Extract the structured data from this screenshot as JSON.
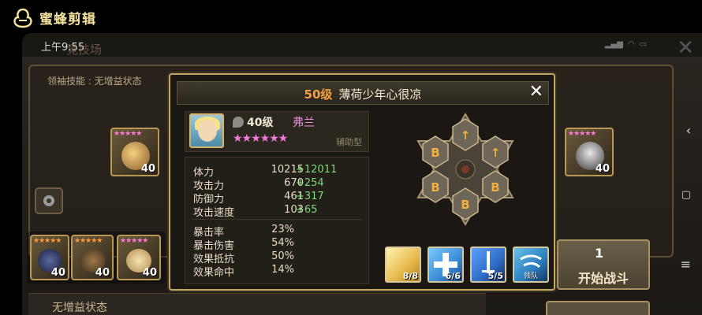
{
  "watermark": {
    "text": "蜜蜂剪辑"
  },
  "status_bar": {
    "time": "上午9:55"
  },
  "background": {
    "title": "竞技场",
    "leader_skill": "领袖技能 : 无增益状态",
    "no_buff_label": "无增益状态",
    "start_button": {
      "count": "1",
      "label": "开始战斗"
    },
    "left_monster": {
      "level": "40",
      "stars": "★★★★★"
    },
    "right_monster": {
      "level": "40",
      "stars": "★★★★★"
    },
    "team": [
      {
        "level": "40",
        "stars": "★★★★★"
      },
      {
        "level": "40",
        "stars": "★★★★★"
      },
      {
        "level": "40",
        "stars": "★★★★★"
      }
    ]
  },
  "popup": {
    "level": "50级",
    "player_name": "薄荷少年心很凉",
    "monster": {
      "level": "40级",
      "name": "弗兰",
      "stars": "★★★★★★",
      "type": "辅助型"
    },
    "stats": [
      {
        "label": "体力",
        "value": "10215",
        "bonus": "+12011"
      },
      {
        "label": "攻击力",
        "value": "670",
        "bonus": "+254"
      },
      {
        "label": "防御力",
        "value": "461",
        "bonus": "+317"
      },
      {
        "label": "攻击速度",
        "value": "103",
        "bonus": "+65"
      },
      {
        "label": "暴击率",
        "value": "23%",
        "bonus": ""
      },
      {
        "label": "暴击伤害",
        "value": "54%",
        "bonus": ""
      },
      {
        "label": "效果抵抗",
        "value": "50%",
        "bonus": ""
      },
      {
        "label": "效果命中",
        "value": "14%",
        "bonus": ""
      }
    ],
    "skills": [
      {
        "count": "8/8",
        "color": "#e6b84a"
      },
      {
        "count": "6/6",
        "color": "#3a8bd4"
      },
      {
        "count": "5/5",
        "color": "#2f6cc4"
      },
      {
        "tag": "领队",
        "color": "#2b7ec0"
      }
    ]
  }
}
